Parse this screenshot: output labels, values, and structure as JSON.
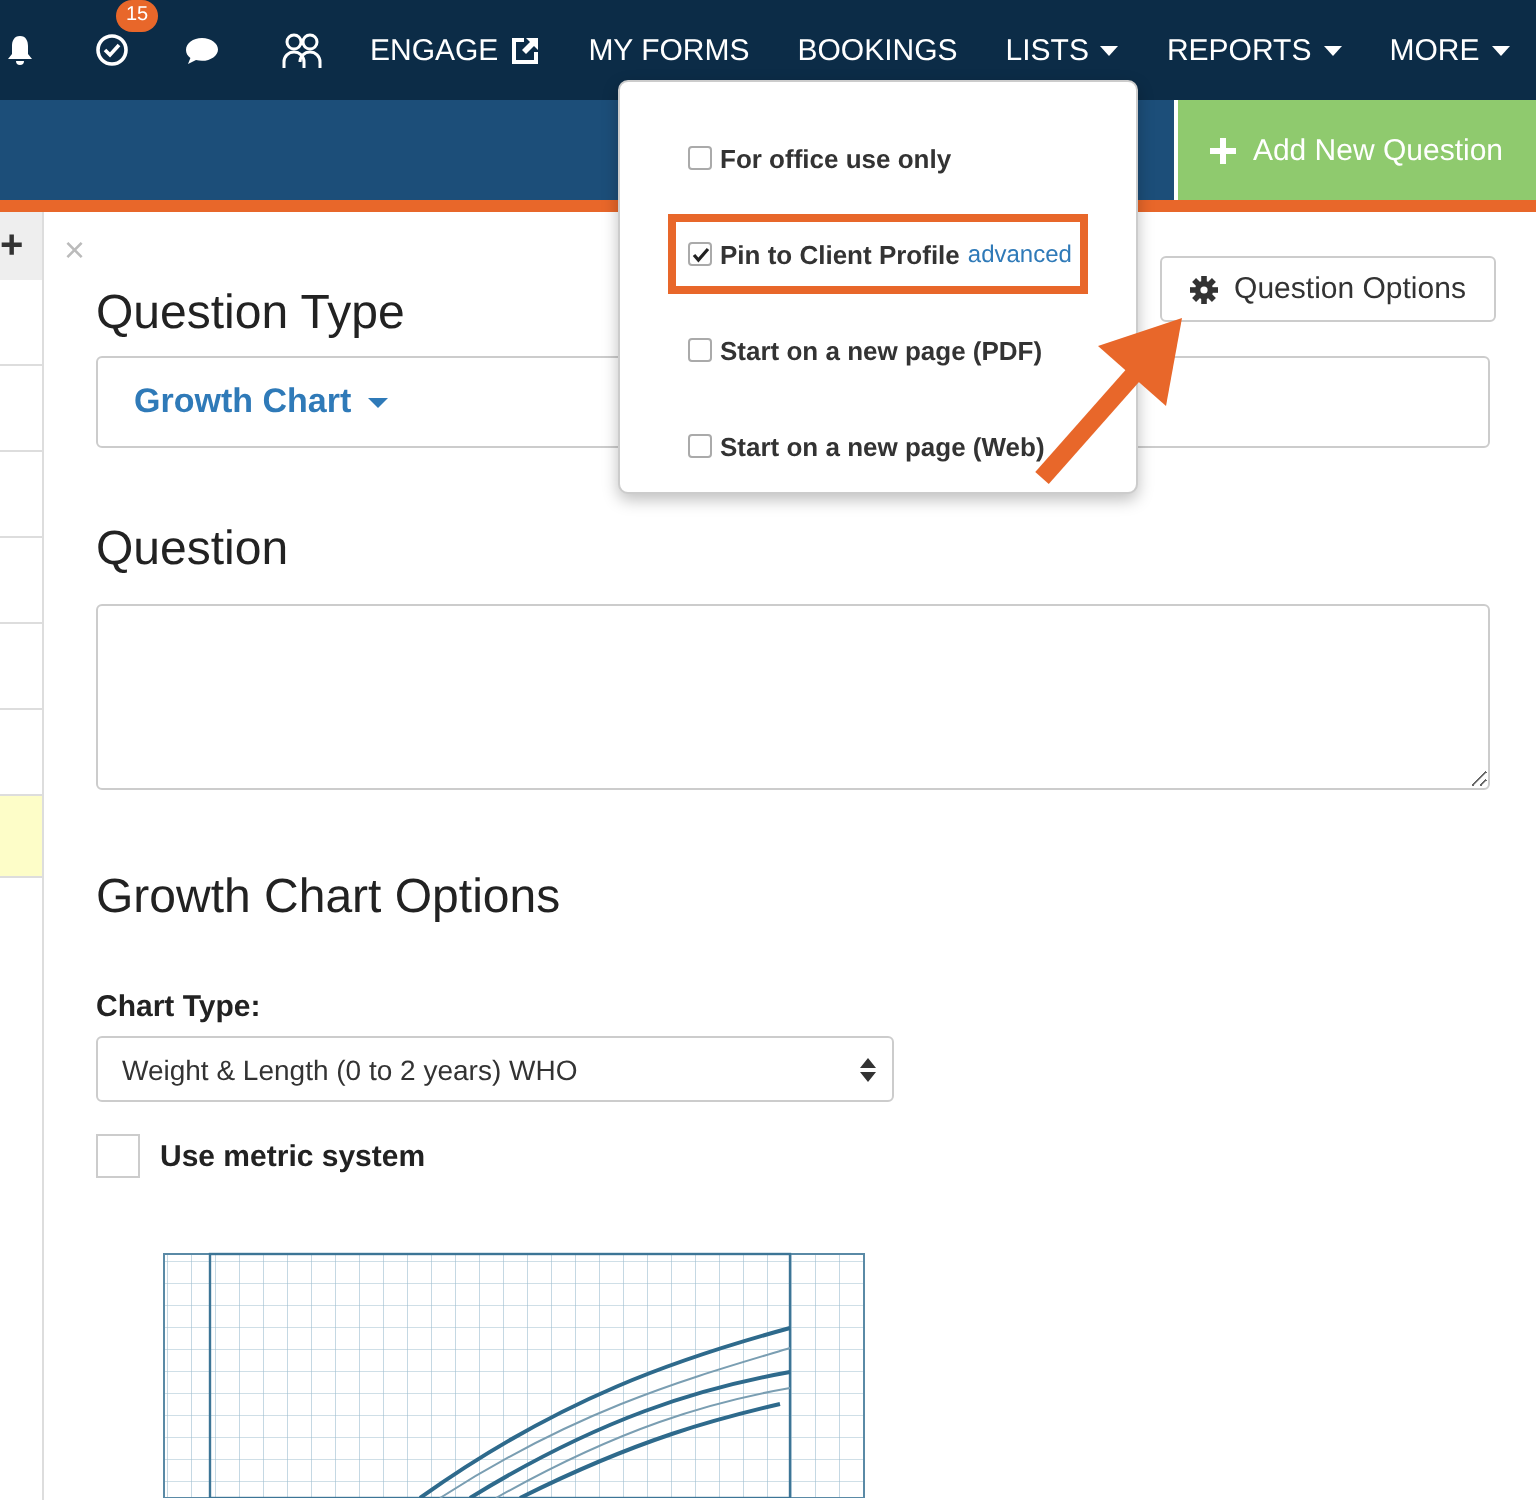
{
  "nav": {
    "icons": [
      {
        "kind": "bell"
      },
      {
        "kind": "tasks",
        "badge": "15"
      },
      {
        "kind": "chat"
      },
      {
        "kind": "people"
      }
    ],
    "items": [
      {
        "label": "ENGAGE",
        "kind": "external"
      },
      {
        "label": "MY FORMS",
        "kind": "link"
      },
      {
        "label": "BOOKINGS",
        "kind": "link"
      },
      {
        "label": "LISTS",
        "kind": "dropdown"
      },
      {
        "label": "REPORTS",
        "kind": "dropdown"
      },
      {
        "label": "MORE",
        "kind": "dropdown"
      }
    ]
  },
  "toolbar": {
    "add_button": "Add New Question"
  },
  "sidebar": {
    "add_label": "+",
    "rows": [
      {
        "selected": false
      },
      {
        "selected": false
      },
      {
        "selected": false
      },
      {
        "selected": false
      },
      {
        "selected": false
      },
      {
        "selected": false
      },
      {
        "selected": true
      }
    ]
  },
  "editor": {
    "close": "×",
    "question_type_label": "Question Type",
    "question_type": "Growth Chart",
    "question_label": "Question",
    "options_button": "Question Options",
    "growth_heading": "Growth Chart Options",
    "chart_type_label": "Chart Type:",
    "chart_type": "Weight & Length (0 to 2 years) WHO",
    "metric": {
      "label": "Use metric system",
      "checked": false
    }
  },
  "popover": {
    "options": [
      {
        "label": "For office use only",
        "checked": false,
        "highlighted": false
      },
      {
        "label": "Pin to Client Profile",
        "checked": true,
        "highlighted": true,
        "link": "advanced"
      },
      {
        "label": "Start on a new page (PDF)",
        "checked": false,
        "highlighted": false
      },
      {
        "label": "Start on a new page (Web)",
        "checked": false,
        "highlighted": false
      }
    ]
  }
}
